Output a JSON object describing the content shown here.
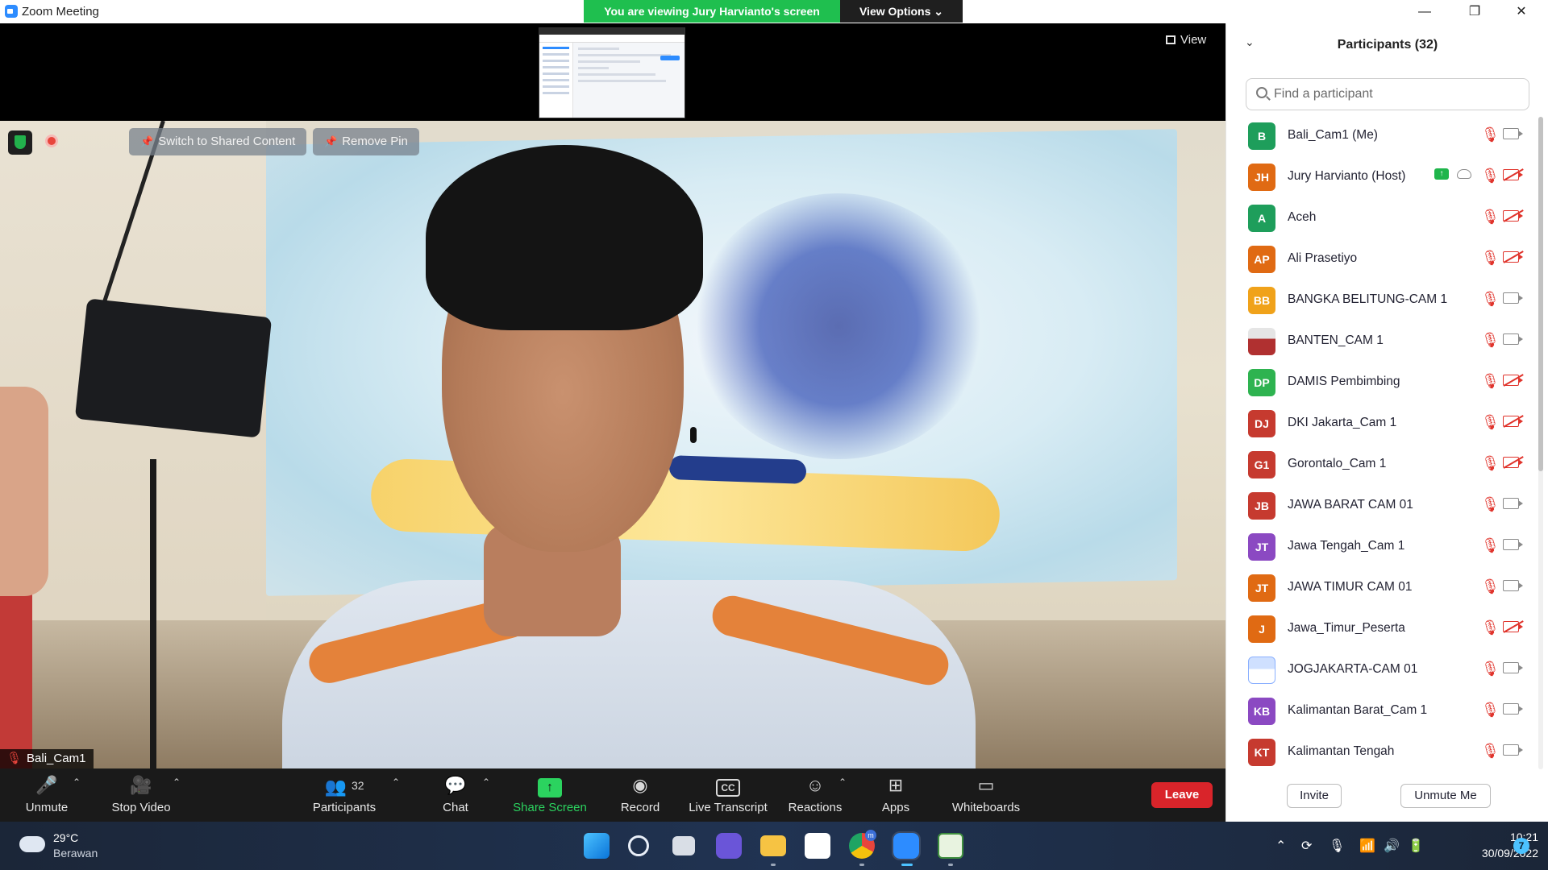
{
  "window": {
    "title": "Zoom Meeting",
    "controls": {
      "minimize": "—",
      "restore": "❐",
      "close": "✕"
    }
  },
  "share_banner": {
    "viewing_text": "You are viewing Jury Harvianto's screen",
    "view_options_label": "View Options"
  },
  "stage": {
    "view_label": "View",
    "switch_content_label": "Switch to Shared Content",
    "remove_pin_label": "Remove Pin",
    "self_name_tag": "Bali_Cam1"
  },
  "toolbar": {
    "unmute_label": "Unmute",
    "stop_video_label": "Stop Video",
    "participants_label": "Participants",
    "participants_count": "32",
    "chat_label": "Chat",
    "share_screen_label": "Share Screen",
    "record_label": "Record",
    "live_transcript_label": "Live Transcript",
    "reactions_label": "Reactions",
    "apps_label": "Apps",
    "whiteboards_label": "Whiteboards",
    "leave_label": "Leave",
    "cc_badge": "CC"
  },
  "participants_panel": {
    "title": "Participants (32)",
    "search_placeholder": "Find a participant",
    "invite_label": "Invite",
    "unmute_me_label": "Unmute Me",
    "participants": [
      {
        "initials": "B",
        "name": "Bali_Cam1 (Me)",
        "color": "#1e9e5b",
        "video_off": false
      },
      {
        "initials": "JH",
        "name": "Jury Harvianto (Host)",
        "color": "#e06a13",
        "video_off": true,
        "sharing": true
      },
      {
        "initials": "A",
        "name": "Aceh",
        "color": "#1e9e5b",
        "video_off": true
      },
      {
        "initials": "AP",
        "name": "Ali Prasetiyo",
        "color": "#e06a13",
        "video_off": true
      },
      {
        "initials": "BB",
        "name": "BANGKA BELITUNG-CAM 1",
        "color": "#f0a21a",
        "video_off": false
      },
      {
        "initials": "",
        "name": "BANTEN_CAM 1",
        "color": "#b03030",
        "video_off": false,
        "photo": "red"
      },
      {
        "initials": "DP",
        "name": "DAMIS Pembimbing",
        "color": "#2eb350",
        "video_off": true
      },
      {
        "initials": "DJ",
        "name": "DKI Jakarta_Cam 1",
        "color": "#c63a2f",
        "video_off": true
      },
      {
        "initials": "G1",
        "name": "Gorontalo_Cam 1",
        "color": "#c63a2f",
        "video_off": true
      },
      {
        "initials": "JB",
        "name": "JAWA BARAT CAM 01",
        "color": "#c63a2f",
        "video_off": false
      },
      {
        "initials": "JT",
        "name": "Jawa Tengah_Cam 1",
        "color": "#8b49c2",
        "video_off": false
      },
      {
        "initials": "JT",
        "name": "JAWA TIMUR CAM 01",
        "color": "#e06a13",
        "video_off": false
      },
      {
        "initials": "J",
        "name": "Jawa_Timur_Peserta",
        "color": "#e06a13",
        "video_off": true
      },
      {
        "initials": "",
        "name": "JOGJAKARTA-CAM 01",
        "color": "#2d6cdf",
        "video_off": false,
        "photo": "blue"
      },
      {
        "initials": "KB",
        "name": "Kalimantan Barat_Cam 1",
        "color": "#8b49c2",
        "video_off": false
      },
      {
        "initials": "KT",
        "name": "Kalimantan Tengah",
        "color": "#c63a2f",
        "video_off": false
      }
    ]
  },
  "taskbar": {
    "temperature": "29°C",
    "weather": "Berawan",
    "time": "10:21",
    "date": "30/09/2022",
    "notification_count": "7",
    "chrome_badge": "m"
  }
}
